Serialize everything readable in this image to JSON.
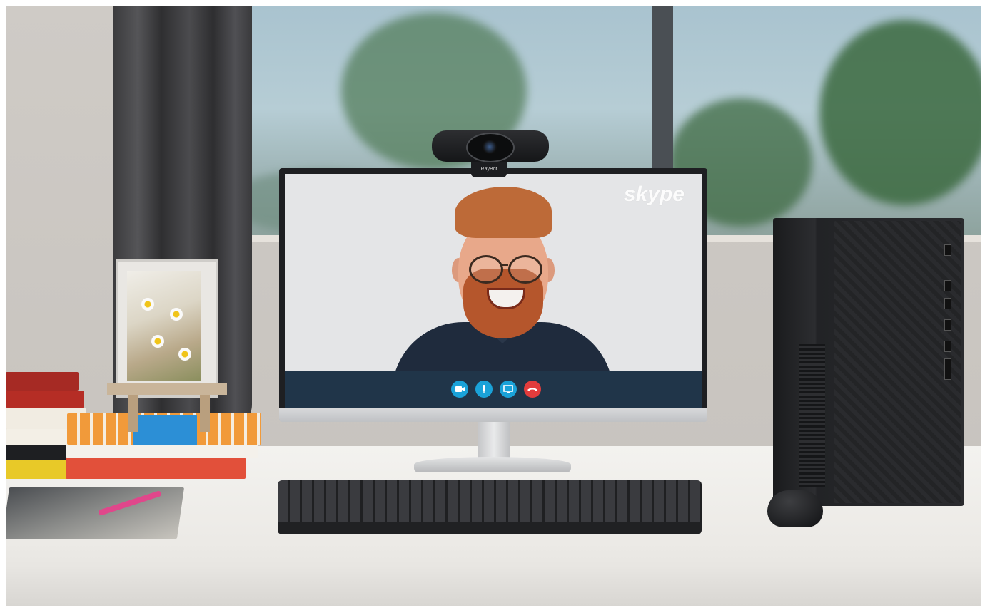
{
  "screen": {
    "app_logo": "skype",
    "call_controls": [
      {
        "icon": "video-icon",
        "color": "#1aa2d8"
      },
      {
        "icon": "microphone-icon",
        "color": "#1aa2d8"
      },
      {
        "icon": "screen-share-icon",
        "color": "#1aa2d8"
      },
      {
        "icon": "end-call-icon",
        "color": "#e23c3c"
      }
    ]
  },
  "webcam": {
    "brand": "RayBot"
  }
}
